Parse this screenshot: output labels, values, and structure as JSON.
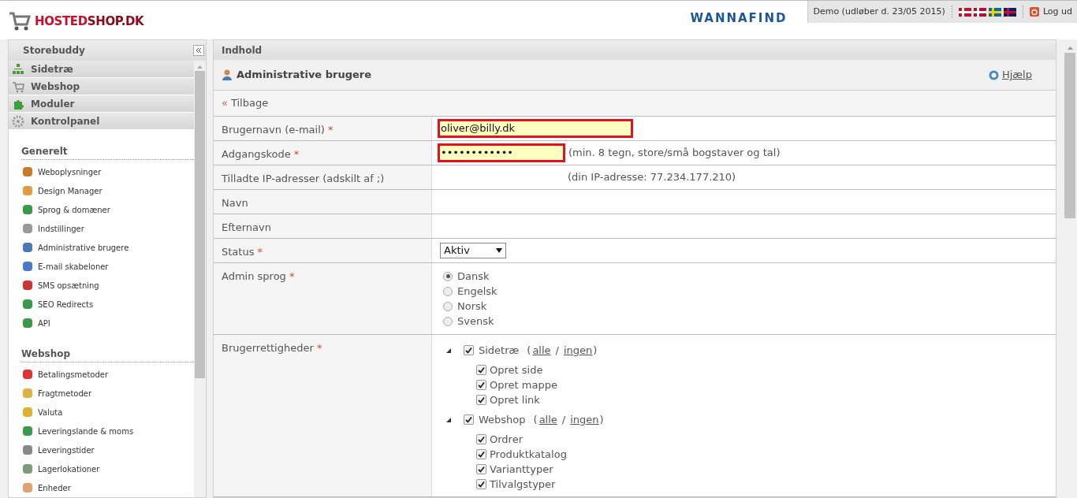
{
  "header": {
    "logo_primary": "HOSTED",
    "logo_secondary": "SHOP.DK",
    "brand": "WANNAFIND",
    "account": "Demo (udløber d. 23/05 2015)",
    "logout": "Log ud"
  },
  "sidebar": {
    "title": "Storebuddy",
    "modules": [
      {
        "label": "Sidetræ"
      },
      {
        "label": "Webshop"
      },
      {
        "label": "Moduler"
      },
      {
        "label": "Kontrolpanel"
      }
    ],
    "sections": [
      {
        "title": "Generelt",
        "items": [
          {
            "label": "Weboplysninger"
          },
          {
            "label": "Design Manager"
          },
          {
            "label": "Sprog & domæner"
          },
          {
            "label": "Indstillinger"
          },
          {
            "label": "Administrative brugere"
          },
          {
            "label": "E-mail skabeloner"
          },
          {
            "label": "SMS opsætning"
          },
          {
            "label": "SEO Redirects"
          },
          {
            "label": "API"
          }
        ]
      },
      {
        "title": "Webshop",
        "items": [
          {
            "label": "Betalingsmetoder"
          },
          {
            "label": "Fragtmetoder"
          },
          {
            "label": "Valuta"
          },
          {
            "label": "Leveringslande & moms"
          },
          {
            "label": "Leveringstider"
          },
          {
            "label": "Lagerlokationer"
          },
          {
            "label": "Enheder"
          }
        ]
      }
    ]
  },
  "content": {
    "panel_title": "Indhold",
    "page_title": "Administrative brugere",
    "help": "Hjælp",
    "back": {
      "arrow": "«",
      "label": "Tilbage"
    },
    "rows": [
      {
        "kind": "input",
        "label": "Brugernavn (e-mail)",
        "mark": "*",
        "value": "oliver@billy.dk",
        "invalid": true
      },
      {
        "kind": "input",
        "label": "Adgangskode",
        "mark": "*",
        "value": "••••••••••••",
        "invalid": true,
        "hint": "(min. 8 tegn, store/små bogstaver og tal)"
      },
      {
        "kind": "note",
        "label": "Tilladte IP-adresser (adskilt af ;)",
        "hint": "(din IP-adresse: 77.234.177.210)"
      },
      {
        "kind": "empty",
        "label": "Navn"
      },
      {
        "kind": "empty",
        "label": "Efternavn"
      },
      {
        "kind": "select",
        "label": "Status",
        "mark": "*",
        "value": "Aktiv"
      },
      {
        "kind": "radio",
        "label": "Admin sprog",
        "mark": "*",
        "options": [
          {
            "label": "Dansk",
            "selected": true
          },
          {
            "label": "Engelsk",
            "selected": false
          },
          {
            "label": "Norsk",
            "selected": false
          },
          {
            "label": "Svensk",
            "selected": false
          }
        ]
      },
      {
        "kind": "tree",
        "label": "Brugerrettigheder",
        "mark": "*",
        "groups": [
          {
            "label": "Sidetræ",
            "checked": true,
            "expanded": true,
            "open": "(",
            "separator": "/",
            "close": ")",
            "links": [
              "alle",
              "ingen"
            ],
            "children": [
              {
                "label": "Opret side",
                "checked": true
              },
              {
                "label": "Opret mappe",
                "checked": true
              },
              {
                "label": "Opret link",
                "checked": true
              }
            ]
          },
          {
            "label": "Webshop",
            "checked": true,
            "expanded": true,
            "open": "(",
            "separator": "/",
            "close": ")",
            "links": [
              "alle",
              "ingen"
            ],
            "children": [
              {
                "label": "Ordrer",
                "checked": true
              },
              {
                "label": "Produktkatalog",
                "checked": true
              },
              {
                "label": "Varianttyper",
                "checked": true
              },
              {
                "label": "Tilvalgstyper",
                "checked": true
              }
            ]
          }
        ]
      }
    ]
  }
}
